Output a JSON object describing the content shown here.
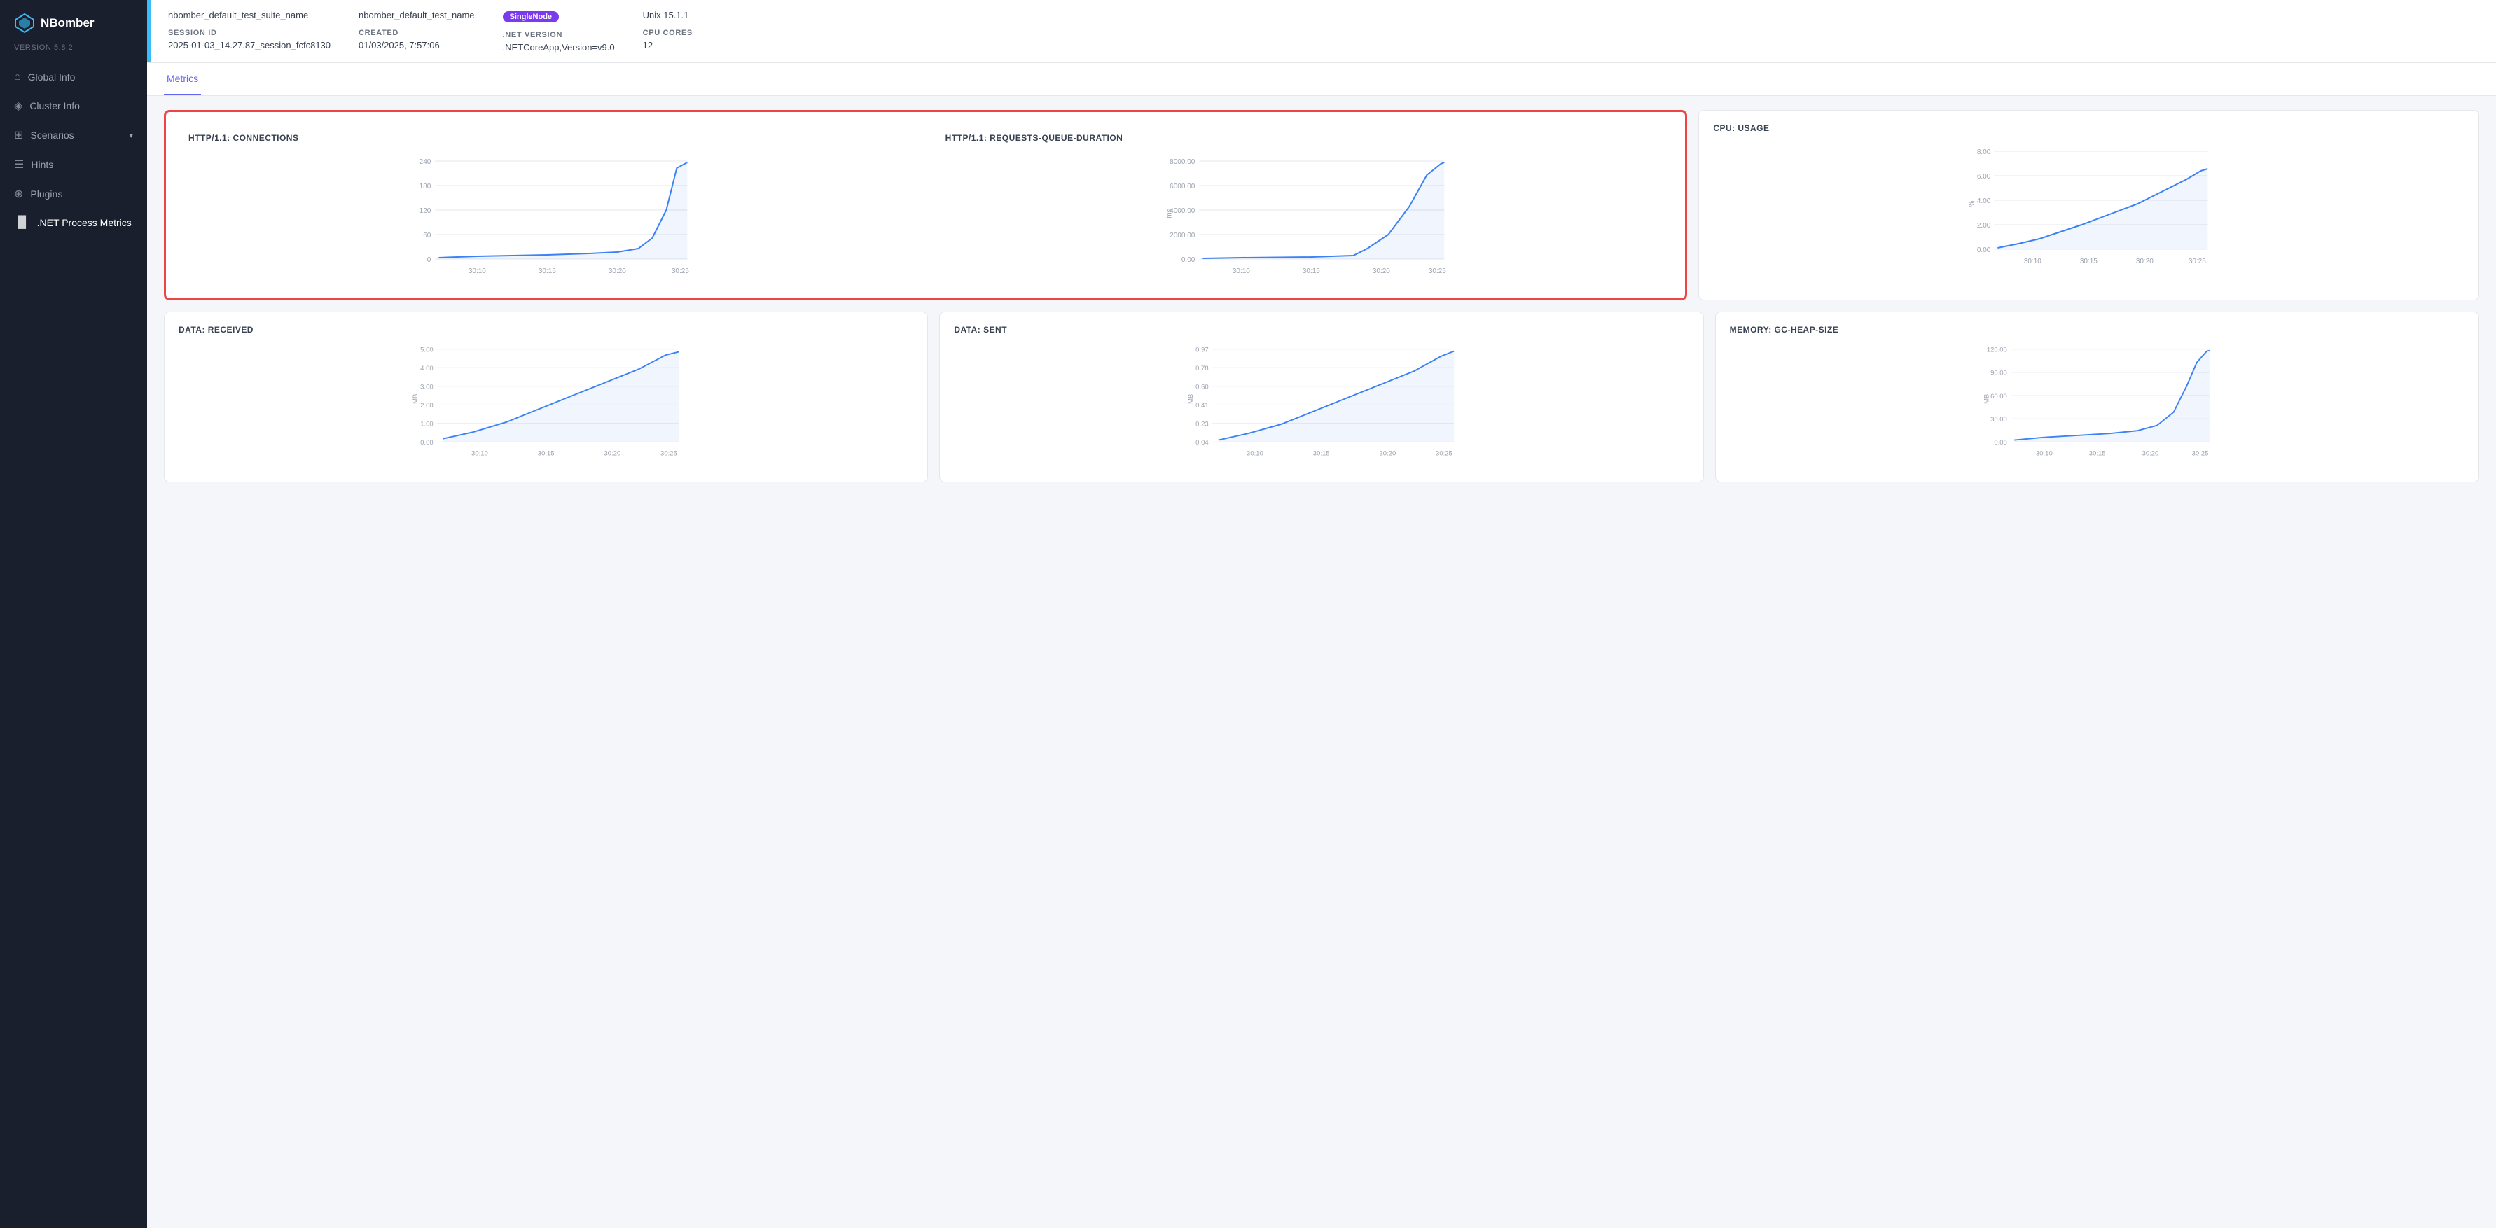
{
  "app": {
    "name": "NBomber",
    "version": "VERSION 5.8.2"
  },
  "sidebar": {
    "items": [
      {
        "id": "global-info",
        "label": "Global Info",
        "icon": "🏠",
        "active": false
      },
      {
        "id": "cluster-info",
        "label": "Cluster Info",
        "icon": "⬡",
        "active": false
      },
      {
        "id": "scenarios",
        "label": "Scenarios",
        "icon": "⊞",
        "active": false,
        "hasChevron": true
      },
      {
        "id": "hints",
        "label": "Hints",
        "icon": "📋",
        "active": false
      },
      {
        "id": "plugins",
        "label": "Plugins",
        "icon": "🔌",
        "active": false
      },
      {
        "id": "net-process-metrics",
        "label": ".NET Process Metrics",
        "icon": "📊",
        "active": true
      }
    ]
  },
  "info_bar": {
    "suite_name_1": "nbomber_default_test_suite_name",
    "suite_name_2": "nbomber_default_test_name",
    "node_type_badge": "SingleNode",
    "os_version": "Unix 15.1.1",
    "session_id_label": "SESSION ID",
    "session_id_value": "2025-01-03_14.27.87_session_fcfc8130",
    "created_label": "CREATED",
    "created_value": "01/03/2025, 7:57:06",
    "net_version_label": ".NET VERSION",
    "net_version_value": ".NETCoreApp,Version=v9.0",
    "cpu_cores_label": "CPU CORES",
    "cpu_cores_value": "12"
  },
  "tabs": [
    {
      "id": "metrics",
      "label": "Metrics",
      "active": true
    }
  ],
  "charts": {
    "row1_highlighted": true,
    "row1": [
      {
        "id": "http-connections",
        "title": "HTTP/1.1: CONNECTIONS",
        "y_labels": [
          "240",
          "180",
          "120",
          "60",
          "0"
        ],
        "x_labels": [
          "30:10",
          "30:15",
          "30:20",
          "30:25"
        ],
        "curve": "flat_then_spike"
      },
      {
        "id": "http-requests-queue",
        "title": "HTTP/1.1: REQUESTS-QUEUE-DURATION",
        "y_labels": [
          "8000.00",
          "6000.00",
          "4000.00",
          "2000.00",
          "0.00"
        ],
        "x_labels": [
          "30:10",
          "30:15",
          "30:20",
          "30:25"
        ],
        "y_unit": "ms",
        "curve": "flat_then_spike"
      }
    ],
    "row1_side": {
      "id": "cpu-usage",
      "title": "CPU: USAGE",
      "y_labels": [
        "8.00",
        "6.00",
        "4.00",
        "2.00",
        "0.00"
      ],
      "x_labels": [
        "30:10",
        "30:15",
        "30:20",
        "30:25"
      ],
      "y_unit": "%",
      "curve": "steady_rise"
    },
    "row2": [
      {
        "id": "data-received",
        "title": "DATA: RECEIVED",
        "y_labels": [
          "5.00",
          "4.00",
          "3.00",
          "2.00",
          "1.00",
          "0.00"
        ],
        "x_labels": [
          "30:10",
          "30:15",
          "30:20",
          "30:25"
        ],
        "y_unit": "MB",
        "curve": "steady_rise"
      },
      {
        "id": "data-sent",
        "title": "DATA: SENT",
        "y_labels": [
          "0.97",
          "0.78",
          "0.60",
          "0.41",
          "0.23",
          "0.04"
        ],
        "x_labels": [
          "30:10",
          "30:15",
          "30:20",
          "30:25"
        ],
        "y_unit": "MB",
        "curve": "steady_rise"
      }
    ],
    "row2_side": {
      "id": "memory-gc-heap",
      "title": "MEMORY: GC-HEAP-SIZE",
      "y_labels": [
        "120.00",
        "90.00",
        "60.00",
        "30.00",
        "0.00"
      ],
      "x_labels": [
        "30:10",
        "30:15",
        "30:20",
        "30:25"
      ],
      "y_unit": "MB",
      "curve": "flat_then_spike"
    }
  }
}
